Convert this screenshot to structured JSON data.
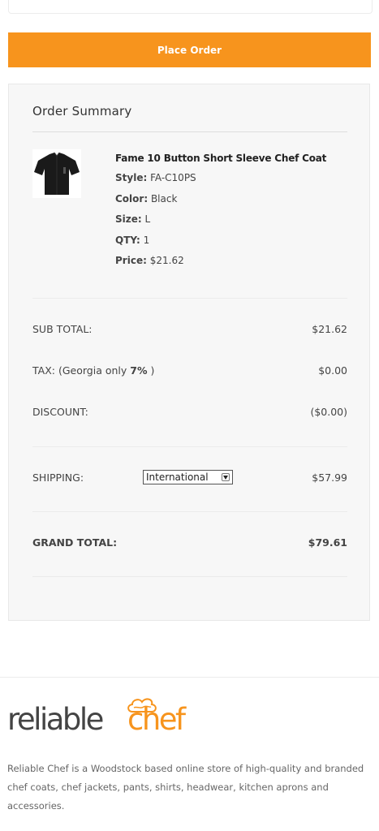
{
  "checkout": {
    "place_order_label": "Place Order"
  },
  "summary": {
    "title": "Order Summary",
    "item": {
      "name": "Fame 10 Button Short Sleeve Chef Coat",
      "image_icon": "black-chef-coat",
      "specs": [
        {
          "key": "Style:",
          "value": "FA-C10PS"
        },
        {
          "key": "Color:",
          "value": "Black"
        },
        {
          "key": "Size:",
          "value": "L"
        },
        {
          "key": "QTY:",
          "value": "1"
        },
        {
          "key": "Price:",
          "value": "$21.62"
        }
      ]
    },
    "subtotal_label": "SUB TOTAL:",
    "subtotal_value": "$21.62",
    "tax_label_prefix": "TAX: (Georgia only ",
    "tax_rate": "7%",
    "tax_label_suffix": " )",
    "tax_value": "$0.00",
    "discount_label": "DISCOUNT:",
    "discount_value": "($0.00)",
    "shipping_label": "SHIPPING:",
    "shipping_selected": "International",
    "shipping_value": "$57.99",
    "grand_total_label": "GRAND TOTAL:",
    "grand_total_value": "$79.61"
  },
  "footer": {
    "logo_text_1": "reliable",
    "logo_text_2": "chef",
    "about_text": "Reliable Chef is a Woodstock based online store of high-quality and branded chef coats, chef jackets, pants, shirts, headwear, kitchen aprons and accessories."
  },
  "colors": {
    "accent": "#f7941d",
    "panel_bg": "#f7f7f7",
    "text": "#444444"
  }
}
